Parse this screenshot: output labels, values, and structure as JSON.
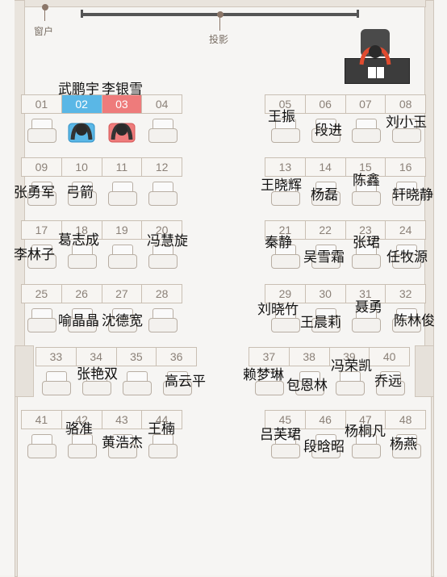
{
  "labels": {
    "window": "窗户",
    "projector": "投影"
  },
  "rows": [
    {
      "left": [
        "01",
        "02",
        "03",
        "04"
      ],
      "right": [
        "05",
        "06",
        "07",
        "08"
      ]
    },
    {
      "left": [
        "09",
        "10",
        "11",
        "12"
      ],
      "right": [
        "13",
        "14",
        "15",
        "16"
      ]
    },
    {
      "left": [
        "17",
        "18",
        "19",
        "20"
      ],
      "right": [
        "21",
        "22",
        "23",
        "24"
      ]
    },
    {
      "left": [
        "25",
        "26",
        "27",
        "28"
      ],
      "right": [
        "29",
        "30",
        "31",
        "32"
      ]
    },
    {
      "left": [
        "33",
        "34",
        "35",
        "36"
      ],
      "right": [
        "37",
        "38",
        "39",
        "40"
      ]
    },
    {
      "left": [
        "41",
        "42",
        "43",
        "44"
      ],
      "right": [
        "45",
        "46",
        "47",
        "48"
      ]
    }
  ],
  "names": [
    "武鹏宇",
    "李银雪",
    "王振",
    "段进",
    "刘小玉",
    "张勇军",
    "弓箭",
    "王晓辉",
    "杨磊",
    "陈鑫",
    "轩晓静",
    "葛志成",
    "李林子",
    "冯慧旋",
    "秦静",
    "吴雪霜",
    "张珺",
    "任牧源",
    "喻晶晶",
    "沈德宽",
    "刘晓竹",
    "王晨莉",
    "聂勇",
    "陈林俊",
    "张艳双",
    "高云平",
    "赖梦琳",
    "包恩林",
    "冯荣凯",
    "乔远",
    "骆准",
    "黄浩杰",
    "王楠",
    "吕芙珺",
    "段晗昭",
    "杨桐凡",
    "杨燕"
  ]
}
